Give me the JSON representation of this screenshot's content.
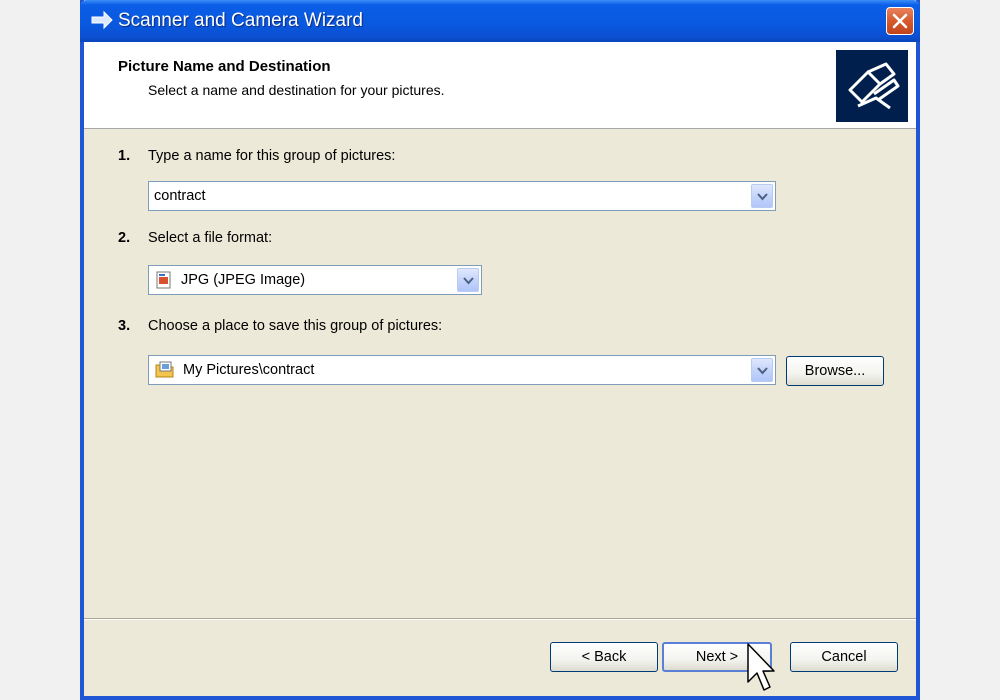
{
  "window": {
    "title": "Scanner and Camera Wizard"
  },
  "header": {
    "title": "Picture Name and Destination",
    "subtitle": "Select a name and destination for your pictures."
  },
  "steps": [
    {
      "number": "1.",
      "label": "Type a name for this group of pictures:",
      "value": "contract"
    },
    {
      "number": "2.",
      "label": "Select a file format:",
      "value": "JPG (JPEG Image)"
    },
    {
      "number": "3.",
      "label": "Choose a place to save this group of pictures:",
      "value": "My Pictures\\contract"
    }
  ],
  "buttons": {
    "browse": "Browse...",
    "back": "< Back",
    "next": "Next >",
    "cancel": "Cancel"
  },
  "colors": {
    "titlebar": "#0a58df",
    "dialog_bg": "#ece9d8",
    "header_icon_bg": "#001f4d",
    "close_button": "#d65a2c"
  },
  "icons": {
    "title": "wizard-arrow-icon",
    "header": "scanner-camera-icon",
    "format": "jpeg-file-icon",
    "folder": "my-pictures-folder-icon"
  }
}
